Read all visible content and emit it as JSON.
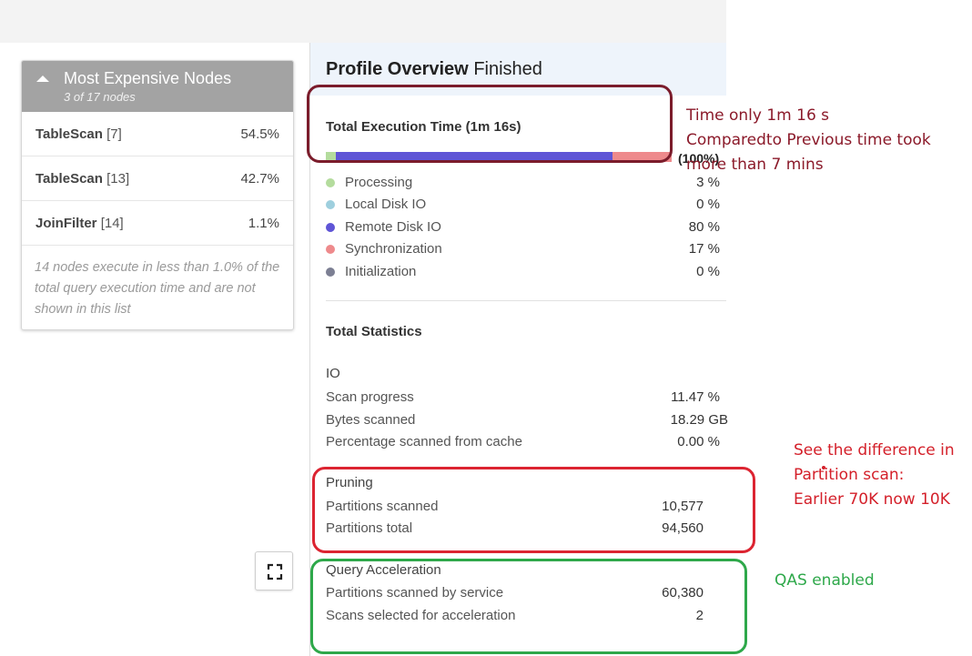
{
  "nodes_panel": {
    "title": "Most Expensive Nodes",
    "subtitle": "3 of 17 nodes",
    "items": [
      {
        "name": "TableScan",
        "index": "[7]",
        "percent": "54.5%"
      },
      {
        "name": "TableScan",
        "index": "[13]",
        "percent": "42.7%"
      },
      {
        "name": "JoinFilter",
        "index": "[14]",
        "percent": "1.1%"
      }
    ],
    "note": "14 nodes execute in less than 1.0% of the total query execution time and are not shown in this list"
  },
  "expand_icon": "fullscreen-icon",
  "overview": {
    "title": "Profile Overview",
    "status": "Finished",
    "execution": {
      "title": "Total Execution Time (1m 16s)",
      "bar_percent": "(100%)",
      "breakdown": [
        {
          "label": "Processing",
          "value": "3 %",
          "fraction": 0.03,
          "color": "#b4dc9d"
        },
        {
          "label": "Local Disk IO",
          "value": "0 %",
          "fraction": 0.0,
          "color": "#9ecfde"
        },
        {
          "label": "Remote Disk IO",
          "value": "80 %",
          "fraction": 0.8,
          "color": "#5f55d6"
        },
        {
          "label": "Synchronization",
          "value": "17 %",
          "fraction": 0.17,
          "color": "#ee8a8c"
        },
        {
          "label": "Initialization",
          "value": "0 %",
          "fraction": 0.0,
          "color": "#7c7f93"
        }
      ]
    },
    "statistics": {
      "title": "Total Statistics",
      "io": {
        "title": "IO",
        "rows": [
          {
            "label": "Scan progress",
            "value": "11.47 %"
          },
          {
            "label": "Bytes scanned",
            "value": "18.29 GB"
          },
          {
            "label": "Percentage scanned from cache",
            "value": "0.00 %"
          }
        ]
      },
      "pruning": {
        "title": "Pruning",
        "rows": [
          {
            "label": "Partitions scanned",
            "value": "10,577"
          },
          {
            "label": "Partitions total",
            "value": "94,560"
          }
        ]
      },
      "acceleration": {
        "title": "Query Acceleration",
        "rows": [
          {
            "label": "Partitions scanned by service",
            "value": "60,380"
          },
          {
            "label": "Scans selected for acceleration",
            "value": "2"
          }
        ]
      }
    }
  },
  "annotations": {
    "time_note": [
      "Time only 1m 16 s",
      "Comparedto Previous time took",
      "more than 7 mins"
    ],
    "partition_note": [
      "See the difference in",
      "Partition scan:",
      "Earlier 70K now 10K"
    ],
    "qas_note": "QAS enabled",
    "colors": {
      "maroon": "#7b1c2b",
      "red": "#dc2431",
      "green": "#2ea84a"
    }
  }
}
